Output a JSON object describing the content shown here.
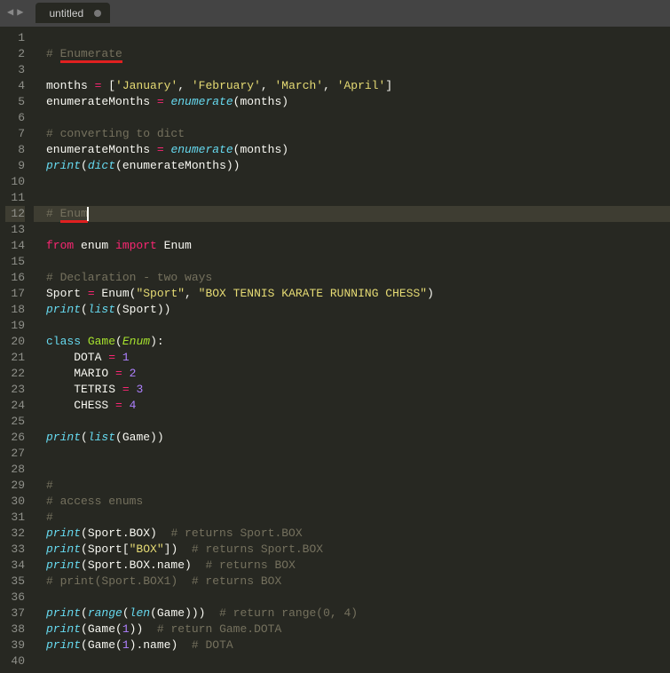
{
  "tab": {
    "title": "untitled"
  },
  "gutter": [
    "1",
    "2",
    "3",
    "4",
    "5",
    "6",
    "7",
    "8",
    "9",
    "10",
    "11",
    "12",
    "13",
    "14",
    "15",
    "16",
    "17",
    "18",
    "19",
    "20",
    "21",
    "22",
    "23",
    "24",
    "25",
    "26",
    "27",
    "28",
    "29",
    "30",
    "31",
    "32",
    "33",
    "34",
    "35",
    "36",
    "37",
    "38",
    "39",
    "40"
  ],
  "activeLine": 12,
  "code": {
    "l2_prefix": "# ",
    "l2_underlined": "Enumerate",
    "l4_a": "months ",
    "l4_eq": "=",
    "l4_sp": " [",
    "l4_s1": "'January'",
    "l4_c1": ", ",
    "l4_s2": "'February'",
    "l4_c2": ", ",
    "l4_s3": "'March'",
    "l4_c3": ", ",
    "l4_s4": "'April'",
    "l4_end": "]",
    "l5_a": "enumerateMonths ",
    "l5_eq": "=",
    "l5_sp": " ",
    "l5_fn": "enumerate",
    "l5_p": "(months)",
    "l7": "# converting to dict",
    "l8_a": "enumerateMonths ",
    "l8_eq": "=",
    "l8_sp": " ",
    "l8_fn": "enumerate",
    "l8_p": "(months)",
    "l9_fn1": "print",
    "l9_p1": "(",
    "l9_fn2": "dict",
    "l9_p2": "(enumerateMonths))",
    "l12_prefix": "# ",
    "l12_underlined": "Enum",
    "l14_from": "from",
    "l14_sp1": " enum ",
    "l14_import": "import",
    "l14_sp2": " Enum",
    "l16": "# Declaration - two ways",
    "l17_a": "Sport ",
    "l17_eq": "=",
    "l17_sp": " Enum(",
    "l17_s1": "\"Sport\"",
    "l17_c": ", ",
    "l17_s2": "\"BOX TENNIS KARATE RUNNING CHESS\"",
    "l17_end": ")",
    "l18_fn1": "print",
    "l18_p1": "(",
    "l18_fn2": "list",
    "l18_p2": "(Sport))",
    "l20_kw": "class",
    "l20_sp": " ",
    "l20_name": "Game",
    "l20_p1": "(",
    "l20_base": "Enum",
    "l20_p2": "):",
    "l21_a": "    DOTA ",
    "l21_eq": "=",
    "l21_sp": " ",
    "l21_n": "1",
    "l22_a": "    MARIO ",
    "l22_eq": "=",
    "l22_sp": " ",
    "l22_n": "2",
    "l23_a": "    TETRIS ",
    "l23_eq": "=",
    "l23_sp": " ",
    "l23_n": "3",
    "l24_a": "    CHESS ",
    "l24_eq": "=",
    "l24_sp": " ",
    "l24_n": "4",
    "l26_fn1": "print",
    "l26_p1": "(",
    "l26_fn2": "list",
    "l26_p2": "(Game))",
    "l29": "#",
    "l30": "# access enums",
    "l31": "#",
    "l32_fn": "print",
    "l32_a": "(Sport.BOX)  ",
    "l32_c": "# returns Sport.BOX",
    "l33_fn": "print",
    "l33_a": "(Sport[",
    "l33_s": "\"BOX\"",
    "l33_b": "])  ",
    "l33_c": "# returns Sport.BOX",
    "l34_fn": "print",
    "l34_a": "(Sport.BOX.name)  ",
    "l34_c": "# returns BOX",
    "l35": "# print(Sport.BOX1)  # returns BOX",
    "l37_fn1": "print",
    "l37_p1": "(",
    "l37_fn2": "range",
    "l37_p2": "(",
    "l37_fn3": "len",
    "l37_p3": "(Game)))  ",
    "l37_c": "# return range(0, 4)",
    "l38_fn": "print",
    "l38_a": "(Game(",
    "l38_n": "1",
    "l38_b": "))  ",
    "l38_c": "# return Game.DOTA",
    "l39_fn": "print",
    "l39_a": "(Game(",
    "l39_n": "1",
    "l39_b": ").name)  ",
    "l39_c": "# DOTA"
  }
}
